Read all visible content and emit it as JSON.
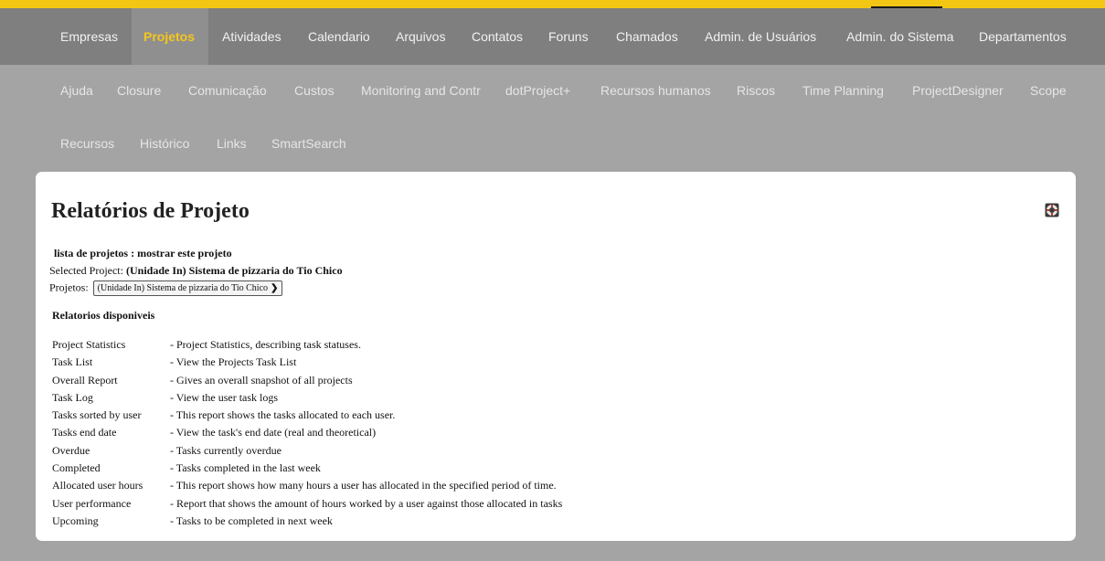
{
  "top_nav": {
    "items": [
      "Empresas",
      "Projetos",
      "Atividades",
      "Calendario",
      "Arquivos",
      "Contatos",
      "Foruns",
      "Chamados",
      "Admin. de Usuários",
      "Admin. do Sistema",
      "Departamentos"
    ],
    "active": "Projetos"
  },
  "module_nav": {
    "row1": [
      "Ajuda",
      "Closure",
      "Comunicação",
      "Custos",
      "Monitoring and Contr",
      "dotProject+",
      "Recursos humanos",
      "Riscos",
      "Time Planning",
      "ProjectDesigner",
      "Scope"
    ],
    "row2": [
      "Recursos",
      "Histórico",
      "Links",
      "SmartSearch"
    ]
  },
  "panel": {
    "title": "Relatórios de Projeto",
    "help_icon": "lifebuoy-icon",
    "breadcrumb": "lista de projetos : mostrar este projeto",
    "selected_project_label": "Selected Project:",
    "selected_project_value": "(Unidade In) Sistema de pizzaria do Tio Chico",
    "projects_label": "Projetos:",
    "projects_select_value": "(Unidade In) Sistema de pizzaria do Tio Chico",
    "available_reports_heading": "Relatorios disponiveis",
    "reports": [
      {
        "name": "Project Statistics",
        "desc": "- Project Statistics, describing task statuses."
      },
      {
        "name": "Task List",
        "desc": "- View the Projects Task List"
      },
      {
        "name": "Overall Report",
        "desc": "- Gives an overall snapshot of all projects"
      },
      {
        "name": "Task Log",
        "desc": "- View the user task logs"
      },
      {
        "name": "Tasks sorted by user",
        "desc": "- This report shows the tasks allocated to each user."
      },
      {
        "name": "Tasks end date",
        "desc": "- View the task's end date (real and theoretical)"
      },
      {
        "name": "Overdue",
        "desc": "- Tasks currently overdue"
      },
      {
        "name": "Completed",
        "desc": "- Tasks completed in the last week"
      },
      {
        "name": "Allocated user hours",
        "desc": "- This report shows how many hours a user has allocated in the specified period of time."
      },
      {
        "name": "User performance",
        "desc": "- Report that shows the amount of hours worked by a user against those allocated in tasks"
      },
      {
        "name": "Upcoming",
        "desc": "- Tasks to be completed in next week"
      }
    ]
  },
  "colors": {
    "accent_yellow": "#f3c614",
    "nav_background": "#7f7f7f",
    "page_background": "#a4a4a4"
  }
}
